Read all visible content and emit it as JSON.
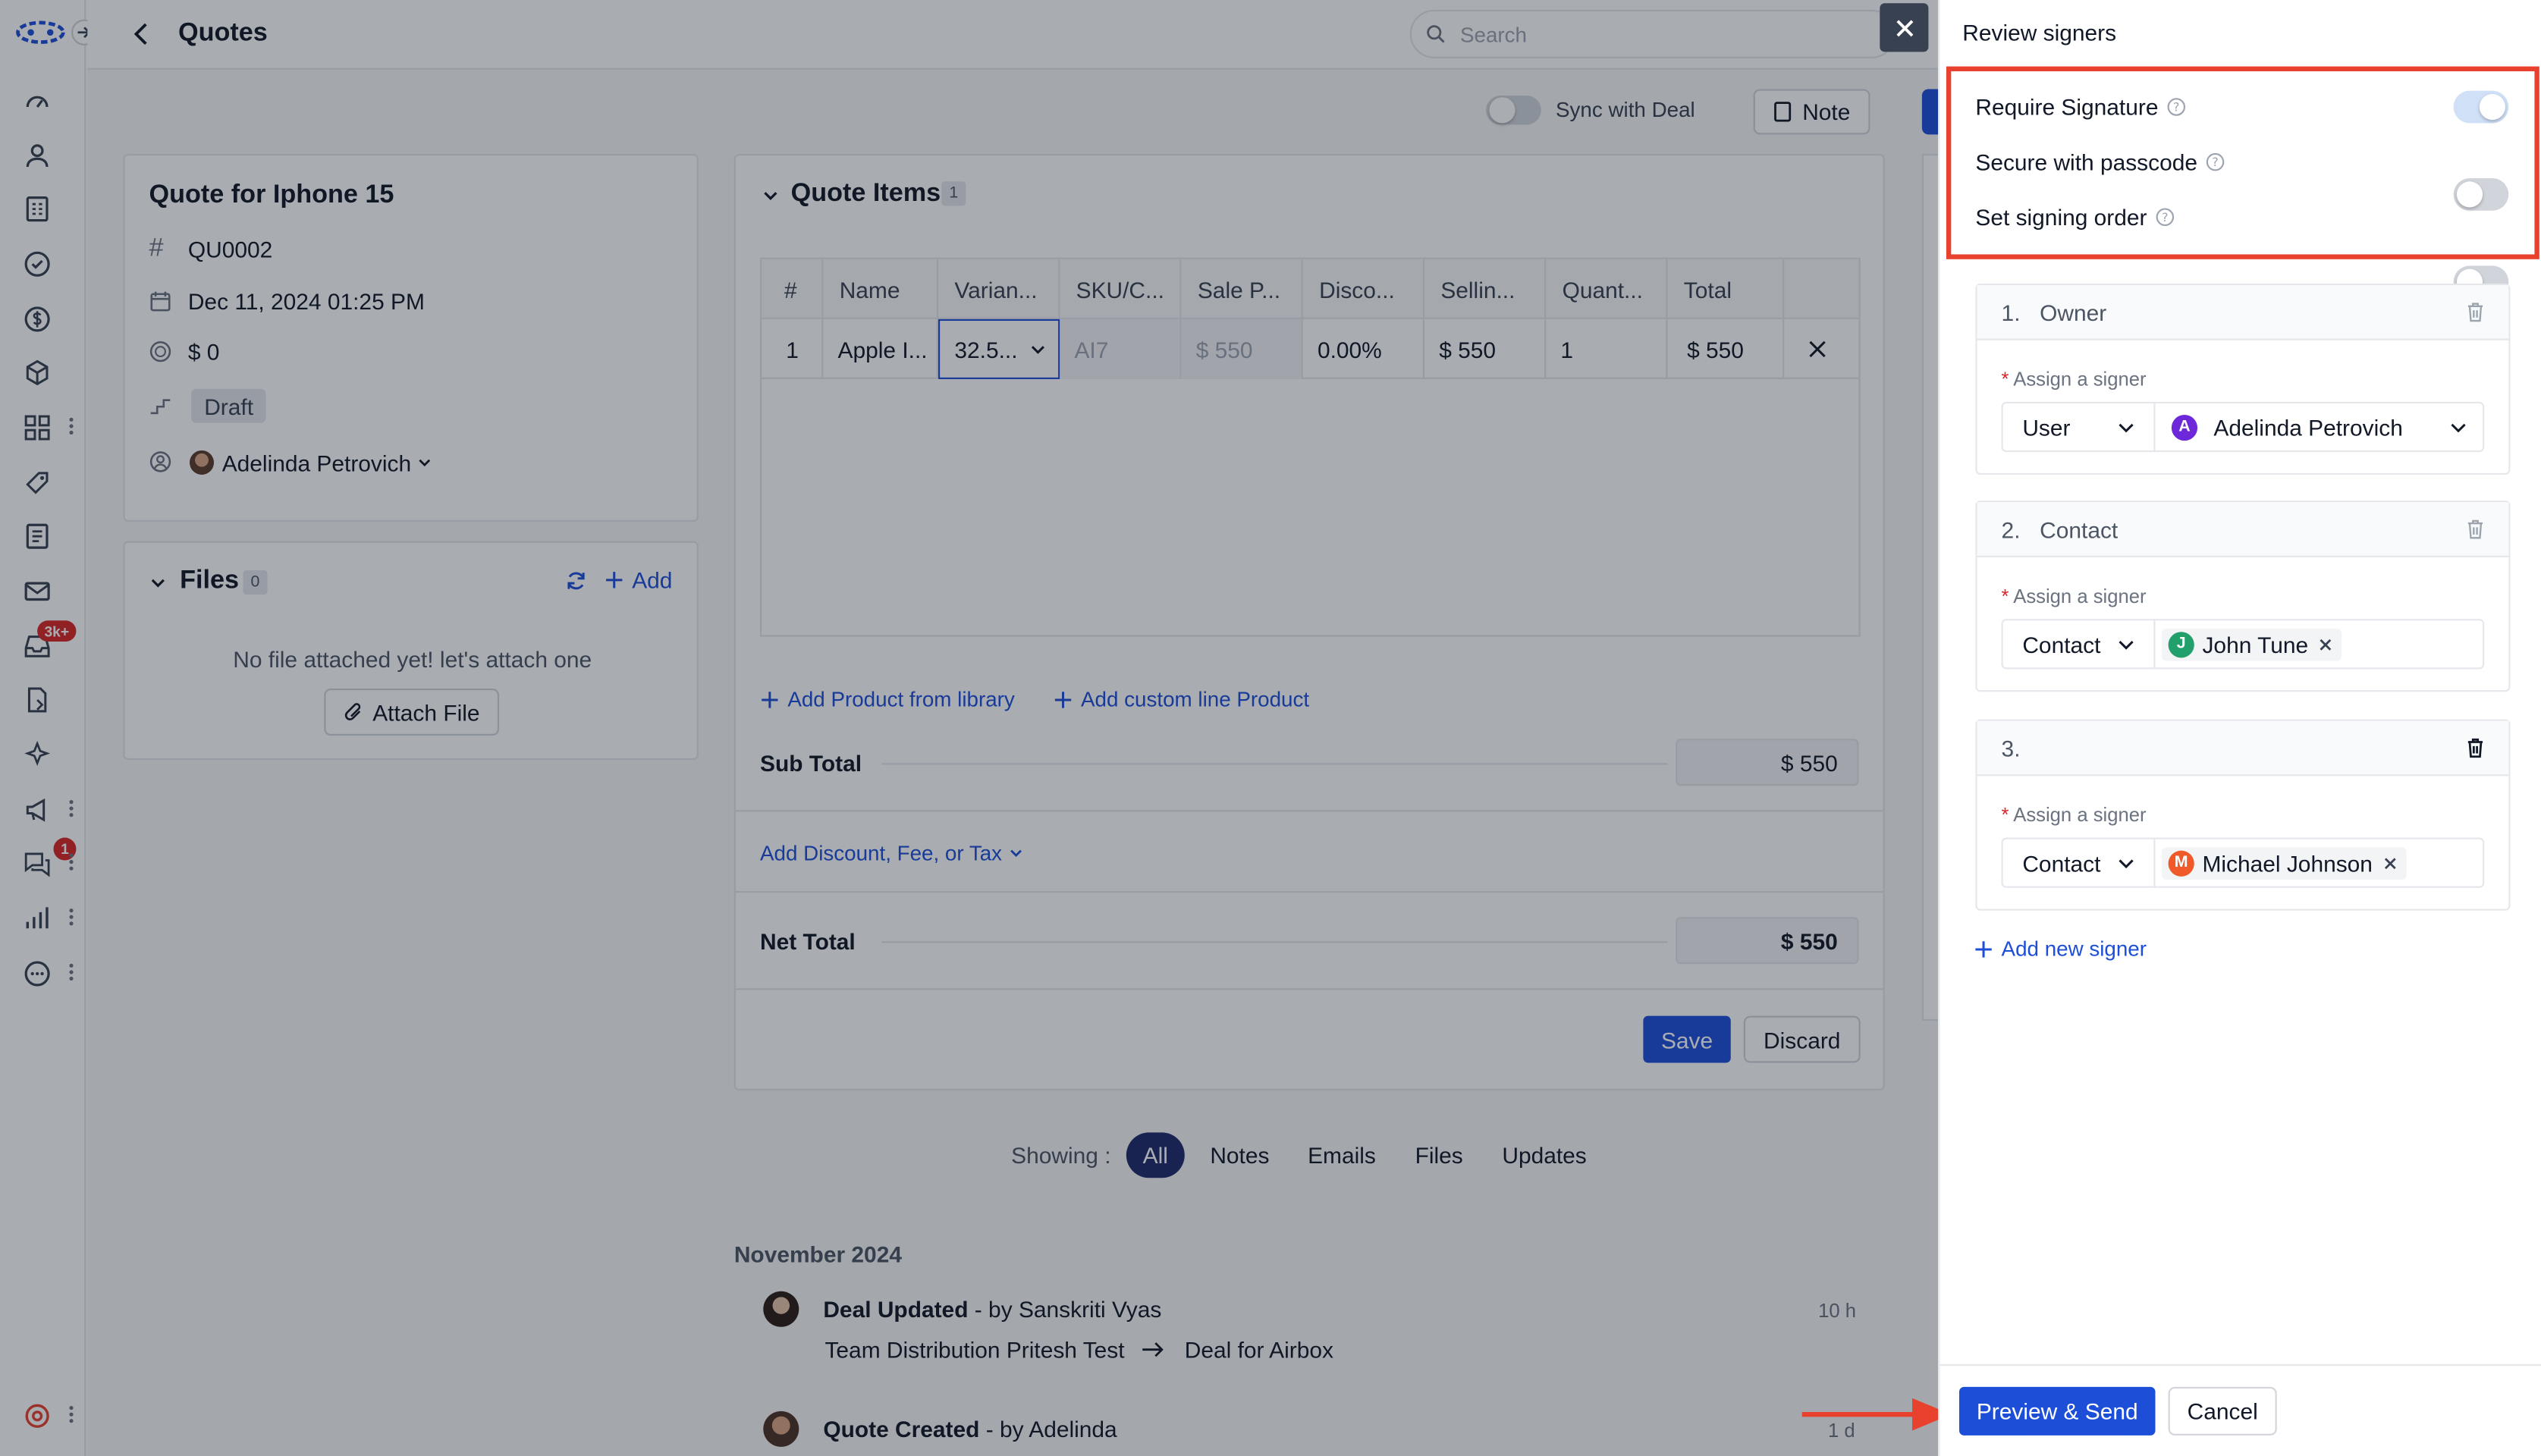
{
  "app": {
    "page_title": "Quotes",
    "search_placeholder": "Search"
  },
  "rail": {
    "badges": {
      "inbox": "3k+",
      "chat": "1"
    }
  },
  "toolbar": {
    "sync_label": "Sync with Deal",
    "note_label": "Note"
  },
  "quote": {
    "title": "Quote for Iphone 15",
    "number": "QU0002",
    "date": "Dec 11, 2024 01:25 PM",
    "amount": "$ 0",
    "status": "Draft",
    "owner": "Adelinda Petrovich"
  },
  "files": {
    "title": "Files",
    "count": "0",
    "add_label": "Add",
    "empty_text": "No file attached yet! let's attach one",
    "attach_label": "Attach File"
  },
  "items": {
    "title": "Quote Items",
    "count": "1",
    "columns": [
      "#",
      "Name",
      "Varian...",
      "SKU/C...",
      "Sale P...",
      "Disco...",
      "Sellin...",
      "Quant...",
      "Total"
    ],
    "rows": [
      {
        "num": "1",
        "name": "Apple I...",
        "variant": "32.5...",
        "sku": "AI7",
        "sale_price": "$ 550",
        "discount": "0.00%",
        "selling": "$ 550",
        "quantity": "1",
        "total": "$ 550"
      }
    ],
    "add_library": "Add Product from library",
    "add_custom": "Add custom line Product",
    "subtotal_label": "Sub Total",
    "subtotal_value": "$ 550",
    "discount_link": "Add Discount, Fee, or Tax",
    "net_label": "Net Total",
    "net_value": "$ 550",
    "save_label": "Save",
    "discard_label": "Discard"
  },
  "activity": {
    "showing_label": "Showing :",
    "tabs": [
      "All",
      "Notes",
      "Emails",
      "Files",
      "Updates"
    ],
    "month": "November 2024",
    "entries": [
      {
        "title": "Deal Updated",
        "by": " - by Sanskriti Vyas",
        "from": "Team Distribution Pritesh Test",
        "to": "Deal for Airbox",
        "time": "10 h"
      },
      {
        "title": "Quote Created",
        "by": " - by Adelinda",
        "time": "1 d"
      }
    ]
  },
  "drawer": {
    "title": "Review signers",
    "options": [
      {
        "label": "Require Signature",
        "on": true
      },
      {
        "label": "Secure with passcode",
        "on": false
      },
      {
        "label": "Set signing order",
        "on": false
      }
    ],
    "assign_label": "Assign a signer",
    "signers": [
      {
        "num": "1.",
        "role": "Owner",
        "type": "User",
        "name": "Adelinda Petrovich",
        "initial": "A",
        "color": "#6d28d9"
      },
      {
        "num": "2.",
        "role": "Contact",
        "type": "Contact",
        "name": "John Tune",
        "initial": "J",
        "color": "#22a06b"
      },
      {
        "num": "3.",
        "role": "",
        "type": "Contact",
        "name": "Michael Johnson",
        "initial": "M",
        "color": "#f05a28"
      }
    ],
    "add_signer": "Add new signer",
    "preview_label": "Preview & Send",
    "cancel_label": "Cancel"
  },
  "colors": {
    "primary": "#1d4ed8",
    "highlight": "#e8412e",
    "dark_pill": "#1e2a6b"
  }
}
